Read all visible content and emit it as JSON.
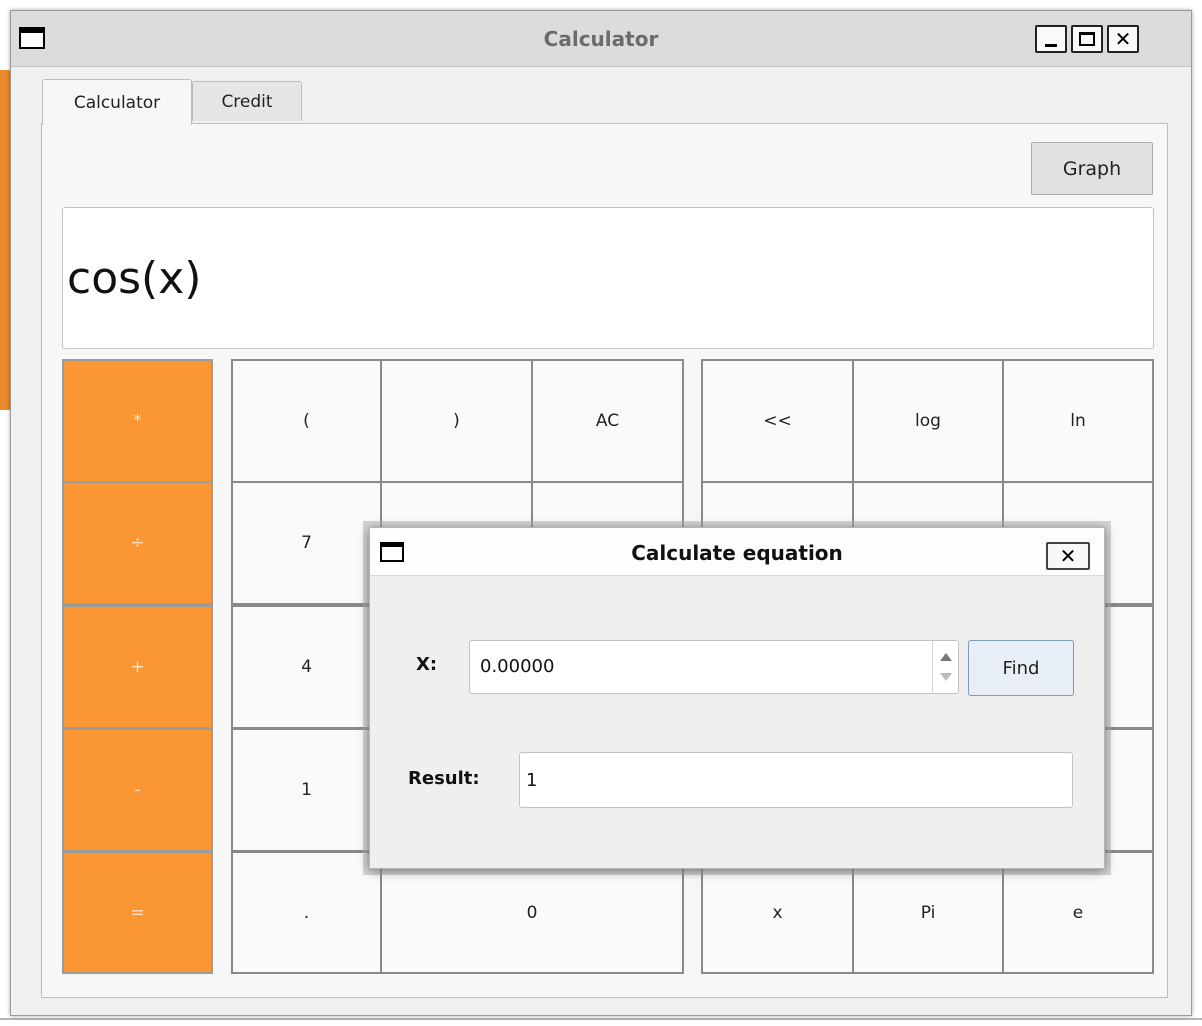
{
  "window": {
    "title": "Calculator"
  },
  "tabs": [
    {
      "label": "Calculator",
      "active": true
    },
    {
      "label": "Credit",
      "active": false
    }
  ],
  "graph_button": "Graph",
  "display": {
    "expression": "cos(x)"
  },
  "keypad": {
    "operators": [
      "*",
      "÷",
      "+",
      "-",
      "="
    ],
    "number_block": [
      [
        "(",
        ")",
        "AC"
      ],
      [
        "7",
        "",
        ""
      ],
      [
        "4",
        "",
        ""
      ],
      [
        "1",
        "",
        ""
      ],
      [
        ".",
        "0"
      ]
    ],
    "function_block": [
      [
        "<<",
        "log",
        "ln"
      ],
      [
        "",
        "",
        ""
      ],
      [
        "",
        "",
        ""
      ],
      [
        "",
        "",
        ""
      ],
      [
        "x",
        "Pi",
        "e"
      ]
    ]
  },
  "dialog": {
    "title": "Calculate equation",
    "x_label": "X:",
    "x_value": "0.00000",
    "find_label": "Find",
    "result_label": "Result:",
    "result_value": "1"
  },
  "colors": {
    "operator_key": "#fa9634",
    "operator_text": "#fde2c4"
  }
}
